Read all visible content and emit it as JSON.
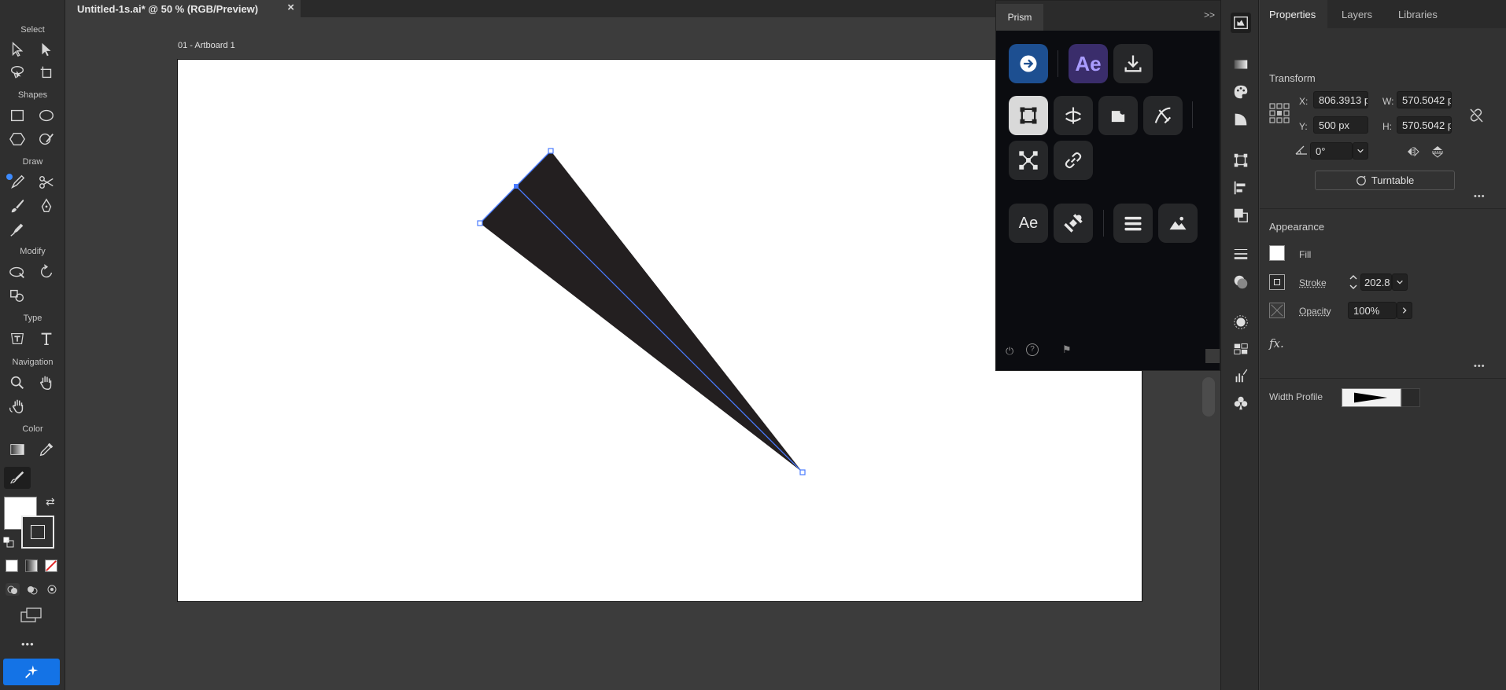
{
  "document": {
    "tab_title": "Untitled-1s.ai* @ 50 % (RGB/Preview)",
    "close_glyph": "×",
    "artboard_label": "01 - Artboard 1"
  },
  "toolbar": {
    "sections": {
      "select": "Select",
      "shapes": "Shapes",
      "draw": "Draw",
      "modify": "Modify",
      "type": "Type",
      "navigation": "Navigation",
      "color": "Color"
    },
    "more_glyph": "•••"
  },
  "prism": {
    "tab_label": "Prism",
    "collapse_glyph": ">>",
    "accent": "#1d4f91",
    "ae_label": "Ae",
    "ae_small_label": "Ae"
  },
  "properties": {
    "tabs": [
      "Properties",
      "Layers",
      "Libraries"
    ],
    "transform": {
      "heading": "Transform",
      "x_label": "X:",
      "x_value": "806.3913 p",
      "y_label": "Y:",
      "y_value": "500 px",
      "w_label": "W:",
      "w_value": "570.5042 p",
      "h_label": "H:",
      "h_value": "570.5042 p",
      "angle_value": "0°",
      "turntable_label": "Turntable"
    },
    "appearance": {
      "heading": "Appearance",
      "fill_label": "Fill",
      "stroke_label": "Stroke",
      "stroke_value": "202.8",
      "opacity_label": "Opacity",
      "opacity_value": "100%",
      "fx_label": "fx."
    },
    "width_profile_label": "Width Profile",
    "more_glyph": "•••"
  },
  "colors": {
    "selection": "#4a7bff",
    "shape_fill": "#231f20",
    "app_accent": "#1473e6"
  }
}
